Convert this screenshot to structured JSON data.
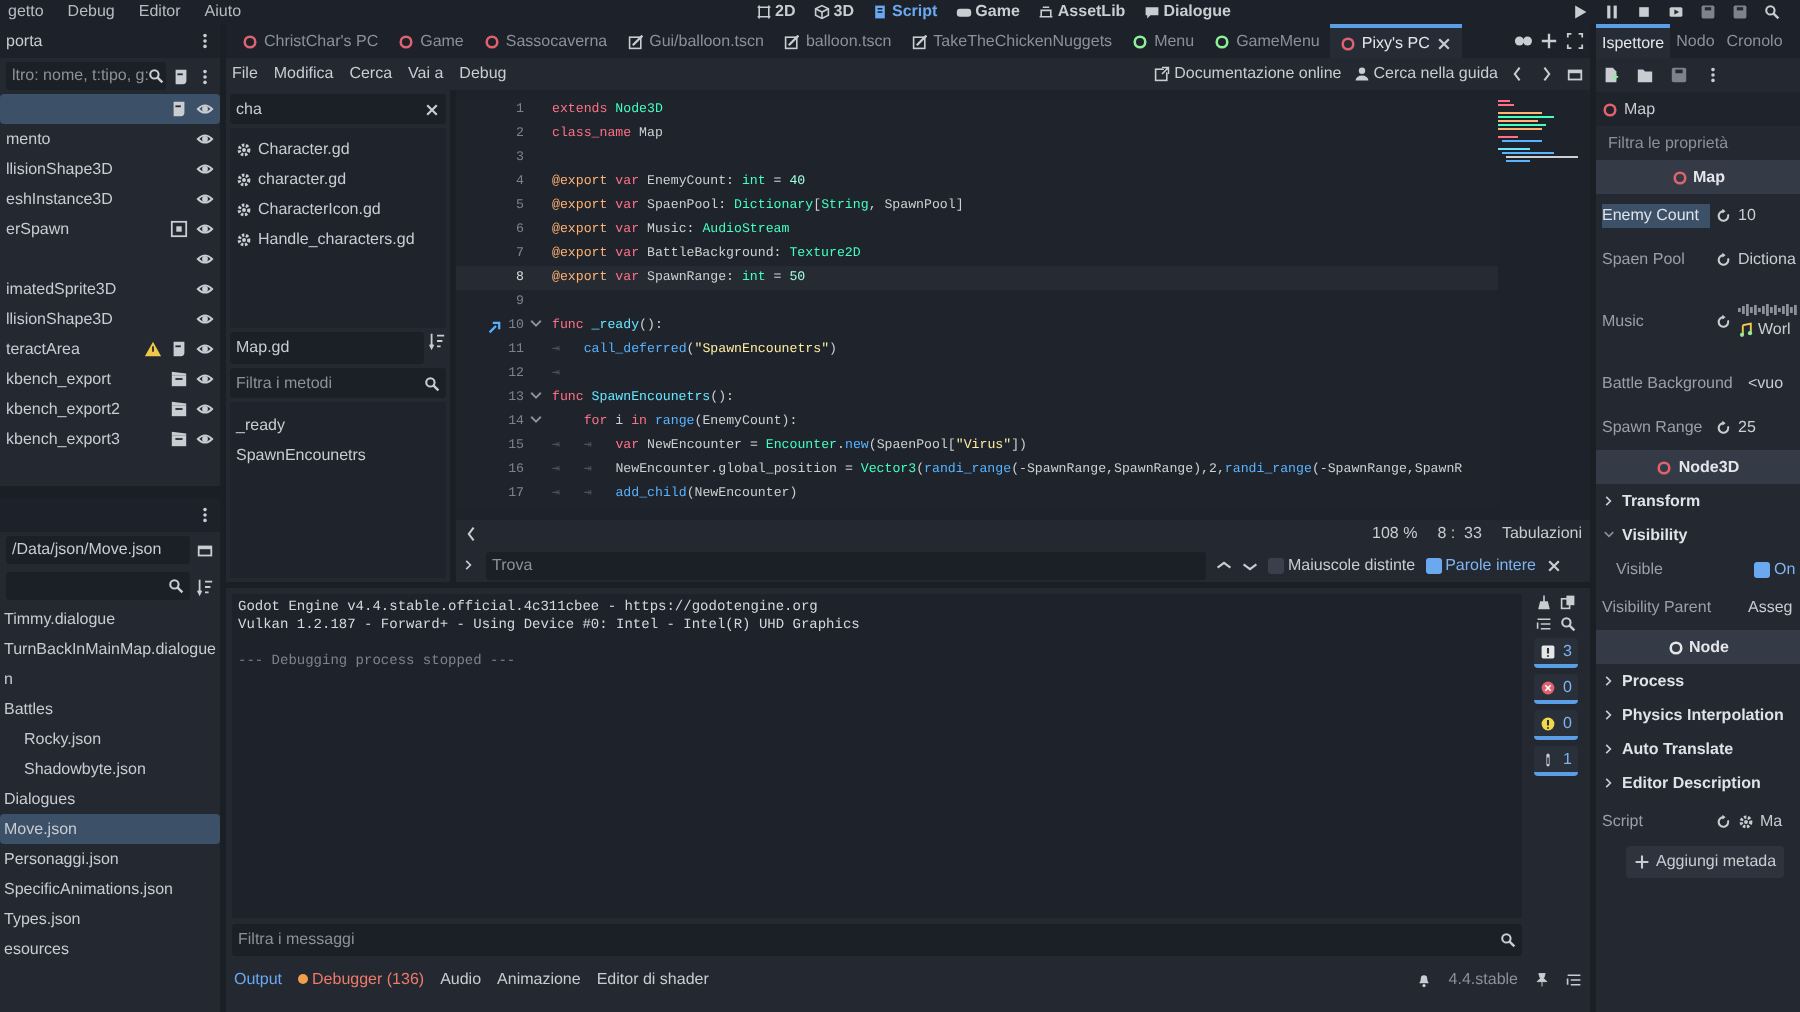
{
  "menu": [
    "getto",
    "Debug",
    "Editor",
    "Aiuto"
  ],
  "main_screens": [
    {
      "label": "2D",
      "kind": "flat",
      "selected": false
    },
    {
      "label": "3D",
      "kind": "cube",
      "selected": false
    },
    {
      "label": "Script",
      "kind": "script",
      "selected": true
    },
    {
      "label": "Game",
      "kind": "game",
      "selected": false
    },
    {
      "label": "AssetLib",
      "kind": "assetlib",
      "selected": false
    },
    {
      "label": "Dialogue",
      "kind": "dialogue",
      "selected": false
    }
  ],
  "scene_dock": {
    "tab": "porta",
    "filter_placeholder": "ltro: nome, t:tipo, g:",
    "nodes": [
      {
        "kind": "script",
        "selected": true
      },
      {
        "label": "mento",
        "kind": "plain",
        "selected": false
      },
      {
        "label": "llisionShape3D",
        "kind": "plain",
        "selected": false
      },
      {
        "label": "eshInstance3D",
        "kind": "plain",
        "selected": false
      },
      {
        "label": "erSpawn",
        "kind": "instance",
        "selected": false
      },
      {
        "kind": "plain",
        "selected": false
      },
      {
        "label": "imatedSprite3D",
        "kind": "plain",
        "selected": false
      },
      {
        "label": "llisionShape3D",
        "kind": "plain",
        "selected": false
      },
      {
        "label": "teractArea",
        "kind": "warning",
        "selected": false
      },
      {
        "label": "kbench_export",
        "kind": "export",
        "selected": false
      },
      {
        "label": "kbench_export2",
        "kind": "export",
        "selected": false
      },
      {
        "label": "kbench_export3",
        "kind": "export",
        "selected": false
      }
    ]
  },
  "filesystem": {
    "path": "/Data/json/Move.json",
    "files": [
      {
        "label": "Timmy.dialogue",
        "selected": false
      },
      {
        "label": "TurnBackInMainMap.dialogue",
        "selected": false
      },
      {
        "label": "n",
        "selected": false
      },
      {
        "label": "Battles",
        "selected": false,
        "children": [
          {
            "label": "Rocky.json",
            "selected": false
          },
          {
            "label": "Shadowbyte.json",
            "selected": false
          }
        ]
      },
      {
        "label": "Dialogues",
        "selected": false
      },
      {
        "label": "Move.json",
        "selected": true
      },
      {
        "label": "Personaggi.json",
        "selected": false
      },
      {
        "label": "SpecificAnimations.json",
        "selected": false
      },
      {
        "label": "Types.json",
        "selected": false
      },
      {
        "label": "esources",
        "selected": false
      }
    ]
  },
  "script_tabs": [
    {
      "label": "ChristChar's PC",
      "kind": "scene",
      "color": "#e0626e",
      "selected": false
    },
    {
      "label": "Game",
      "kind": "scene",
      "color": "#e0626e",
      "selected": false
    },
    {
      "label": "Sassocaverna",
      "kind": "scene",
      "color": "#e0626e",
      "selected": false
    },
    {
      "label": "Gui/balloon.tscn",
      "kind": "file",
      "selected": false
    },
    {
      "label": "balloon.tscn",
      "kind": "file",
      "selected": false
    },
    {
      "label": "TakeTheChickenNuggets",
      "kind": "file",
      "selected": false
    },
    {
      "label": "Menu",
      "kind": "scene",
      "color": "#8eef97",
      "selected": false
    },
    {
      "label": "GameMenu",
      "kind": "scene",
      "color": "#8eef97",
      "selected": false
    },
    {
      "label": "Pixy's PC",
      "kind": "scene",
      "color": "#e0626e",
      "selected": true
    }
  ],
  "script_menu": [
    "File",
    "Modifica",
    "Cerca",
    "Vai a",
    "Debug"
  ],
  "help_buttons": [
    "Documentazione online",
    "Cerca nella guida"
  ],
  "script_search": {
    "value": "cha"
  },
  "scripts": [
    "Character.gd",
    "character.gd",
    "CharacterIcon.gd",
    "Handle_characters.gd"
  ],
  "current_script": "Map.gd",
  "method_filter": {
    "placeholder": "Filtra i metodi"
  },
  "methods": [
    "_ready",
    "SpawnEncounetrs"
  ],
  "code": [
    {
      "num": "1",
      "current": false,
      "fold": false,
      "signal": false,
      "tokens": [
        {
          "kind": "kw",
          "text": "extends"
        },
        {
          "kind": "type",
          "text": " Node3D"
        }
      ]
    },
    {
      "num": "2",
      "current": false,
      "fold": false,
      "signal": false,
      "tokens": [
        {
          "kind": "kw",
          "text": "class_name"
        },
        {
          "kind": "plain",
          "text": " Map"
        }
      ]
    },
    {
      "num": "3",
      "current": false,
      "fold": false,
      "signal": false
    },
    {
      "num": "4",
      "current": false,
      "fold": false,
      "signal": false,
      "tokens": [
        {
          "kind": "anno",
          "text": "@export"
        },
        {
          "kind": "kw",
          "text": " var"
        },
        {
          "kind": "plain",
          "text": " EnemyCount:"
        },
        {
          "kind": "type",
          "text": " int"
        },
        {
          "kind": "plain",
          "text": " ="
        },
        {
          "kind": "num",
          "text": " 40"
        }
      ]
    },
    {
      "num": "5",
      "current": false,
      "fold": false,
      "signal": false,
      "tokens": [
        {
          "kind": "anno",
          "text": "@export"
        },
        {
          "kind": "kw",
          "text": " var"
        },
        {
          "kind": "plain",
          "text": " SpaenPool:"
        },
        {
          "kind": "type",
          "text": " Dictionary"
        },
        {
          "kind": "plain",
          "text": "["
        },
        {
          "kind": "type",
          "text": "String"
        },
        {
          "kind": "plain",
          "text": ", SpawnPool]"
        }
      ]
    },
    {
      "num": "6",
      "current": false,
      "fold": false,
      "signal": false,
      "tokens": [
        {
          "kind": "anno",
          "text": "@export"
        },
        {
          "kind": "kw",
          "text": " var"
        },
        {
          "kind": "plain",
          "text": " Music:"
        },
        {
          "kind": "type",
          "text": " AudioStream"
        }
      ]
    },
    {
      "num": "7",
      "current": false,
      "fold": false,
      "signal": false,
      "tokens": [
        {
          "kind": "anno",
          "text": "@export"
        },
        {
          "kind": "kw",
          "text": " var"
        },
        {
          "kind": "plain",
          "text": " BattleBackground:"
        },
        {
          "kind": "type",
          "text": " Texture2D"
        }
      ]
    },
    {
      "num": "8",
      "current": true,
      "fold": false,
      "signal": false,
      "tokens": [
        {
          "kind": "anno",
          "text": "@export"
        },
        {
          "kind": "kw",
          "text": " var"
        },
        {
          "kind": "plain",
          "text": " SpawnRange:"
        },
        {
          "kind": "type",
          "text": " int"
        },
        {
          "kind": "plain",
          "text": " ="
        },
        {
          "kind": "num",
          "text": " 50"
        }
      ]
    },
    {
      "num": "9",
      "current": false,
      "fold": false,
      "signal": false
    },
    {
      "num": "10",
      "current": false,
      "fold": true,
      "signal": true,
      "tokens": [
        {
          "kind": "kw",
          "text": "func"
        },
        {
          "kind": "def",
          "text": " _ready"
        },
        {
          "kind": "plain",
          "text": "():"
        }
      ]
    },
    {
      "num": "11",
      "current": false,
      "fold": false,
      "signal": false,
      "tokens": [
        {
          "kind": "tab",
          "text": "⇥"
        },
        {
          "kind": "fn",
          "text": "   call_deferred"
        },
        {
          "kind": "plain",
          "text": "("
        },
        {
          "kind": "str",
          "text": "\"SpawnEncounetrs\""
        },
        {
          "kind": "plain",
          "text": ")"
        }
      ]
    },
    {
      "num": "12",
      "current": false,
      "fold": false,
      "signal": false,
      "tokens": [
        {
          "kind": "tab",
          "text": "⇥"
        }
      ]
    },
    {
      "num": "13",
      "current": false,
      "fold": true,
      "signal": false,
      "tokens": [
        {
          "kind": "kw",
          "text": "func"
        },
        {
          "kind": "def",
          "text": " SpawnEncounetrs"
        },
        {
          "kind": "plain",
          "text": "():"
        }
      ]
    },
    {
      "num": "14",
      "current": false,
      "fold": true,
      "signal": false,
      "tokens": [
        {
          "kind": "kw",
          "text": "    for"
        },
        {
          "kind": "plain",
          "text": " i"
        },
        {
          "kind": "kw",
          "text": " in"
        },
        {
          "kind": "fn",
          "text": " range"
        },
        {
          "kind": "plain",
          "text": "(EnemyCount):"
        }
      ]
    },
    {
      "num": "15",
      "current": false,
      "fold": false,
      "signal": false,
      "tokens": [
        {
          "kind": "tab",
          "text": "⇥"
        },
        {
          "kind": "tab",
          "text": "   ⇥"
        },
        {
          "kind": "kw",
          "text": "   var"
        },
        {
          "kind": "plain",
          "text": " NewEncounter ="
        },
        {
          "kind": "type",
          "text": " Encounter"
        },
        {
          "kind": "plain",
          "text": "."
        },
        {
          "kind": "fn",
          "text": "new"
        },
        {
          "kind": "plain",
          "text": "(SpaenPool["
        },
        {
          "kind": "str",
          "text": "\"Virus\""
        },
        {
          "kind": "plain",
          "text": "])"
        }
      ]
    },
    {
      "num": "16",
      "current": false,
      "fold": false,
      "signal": false,
      "tokens": [
        {
          "kind": "tab",
          "text": "⇥"
        },
        {
          "kind": "tab",
          "text": "   ⇥"
        },
        {
          "kind": "plain",
          "text": "   NewEncounter.global_position ="
        },
        {
          "kind": "type",
          "text": " Vector3"
        },
        {
          "kind": "plain",
          "text": "("
        },
        {
          "kind": "fn",
          "text": "randi_range"
        },
        {
          "kind": "plain",
          "text": "(-SpawnRange,SpawnRange),2,"
        },
        {
          "kind": "fn",
          "text": "randi_range"
        },
        {
          "kind": "plain",
          "text": "(-SpawnRange,SpawnR"
        }
      ]
    },
    {
      "num": "17",
      "current": false,
      "fold": false,
      "signal": false,
      "tokens": [
        {
          "kind": "tab",
          "text": "⇥"
        },
        {
          "kind": "tab",
          "text": "   ⇥"
        },
        {
          "kind": "fn",
          "text": "   add_child"
        },
        {
          "kind": "plain",
          "text": "(NewEncounter)"
        }
      ]
    }
  ],
  "status": {
    "zoom": "108 %",
    "position": "8 :  33",
    "indent": "Tabulazioni"
  },
  "find": {
    "placeholder": "Trova",
    "options": [
      {
        "label": "Maiuscole distinte",
        "checked": false
      },
      {
        "label": "Parole intere",
        "checked": true
      }
    ]
  },
  "output": {
    "lines": [
      {
        "text": "Godot Engine v4.4.stable.official.4c311cbee - https://godotengine.org",
        "dim": false
      },
      {
        "text": "Vulkan 1.2.187 - Forward+ - Using Device #0: Intel - Intel(R) UHD Graphics",
        "dim": false
      },
      {
        "text": "--- Debugging process stopped ---",
        "dim": true
      }
    ],
    "counters": [
      {
        "kind": "message",
        "count": "3",
        "on": true
      },
      {
        "kind": "error",
        "count": "0",
        "on": true
      },
      {
        "kind": "warning",
        "count": "0",
        "on": true
      },
      {
        "kind": "info",
        "count": "1",
        "on": true
      }
    ],
    "filter_placeholder": "Filtra i messaggi",
    "tabs": [
      {
        "label": "Output",
        "selected": true,
        "alert": false
      },
      {
        "label": "Debugger (136)",
        "selected": false,
        "alert": true
      },
      {
        "label": "Audio",
        "selected": false,
        "alert": false
      },
      {
        "label": "Animazione",
        "selected": false,
        "alert": false
      },
      {
        "label": "Editor di shader",
        "selected": false,
        "alert": false
      }
    ],
    "version": "4.4.stable"
  },
  "inspector": {
    "tabs": [
      {
        "label": "Ispettore",
        "selected": true
      },
      {
        "label": "Nodo",
        "selected": false
      },
      {
        "label": "Cronolo",
        "selected": false
      }
    ],
    "object": "Map",
    "filter_placeholder": "Filtra le proprietà",
    "rows": [
      {
        "kind": "section",
        "label": "Map",
        "color": "#e0626e"
      },
      {
        "kind": "property",
        "label": "Enemy Count",
        "value": "10",
        "revert": true,
        "selected": true
      },
      {
        "kind": "property",
        "label": "Spaen Pool",
        "value": "Dictiona",
        "revert": true,
        "selected": false
      },
      {
        "kind": "audio",
        "label": "Music",
        "value": "Worl",
        "revert": true,
        "selected": false
      },
      {
        "kind": "property",
        "label": "Battle Background",
        "value": "<vuo",
        "revert": false,
        "selected": false
      },
      {
        "kind": "property",
        "label": "Spawn Range",
        "value": "25",
        "revert": true,
        "selected": false
      },
      {
        "kind": "section",
        "label": "Node3D",
        "color": "#e0626e"
      },
      {
        "kind": "group",
        "label": "Transform",
        "expanded": false
      },
      {
        "kind": "group",
        "label": "Visibility",
        "expanded": true
      },
      {
        "kind": "check",
        "label": "Visible",
        "value": "On",
        "checked": true
      },
      {
        "kind": "property",
        "label": "Visibility Parent",
        "value": "Asseg",
        "revert": false,
        "selected": false
      },
      {
        "kind": "section",
        "label": "Node",
        "color": "#e6e6e6"
      },
      {
        "kind": "group",
        "label": "Process",
        "expanded": false
      },
      {
        "kind": "group",
        "label": "Physics Interpolation",
        "expanded": false
      },
      {
        "kind": "group",
        "label": "Auto Translate",
        "expanded": false
      },
      {
        "kind": "group",
        "label": "Editor Description",
        "expanded": false
      },
      {
        "kind": "script",
        "label": "Script",
        "value": "Ma",
        "revert": true,
        "selected": false
      },
      {
        "kind": "button",
        "label": "Aggiungi metada"
      }
    ]
  }
}
